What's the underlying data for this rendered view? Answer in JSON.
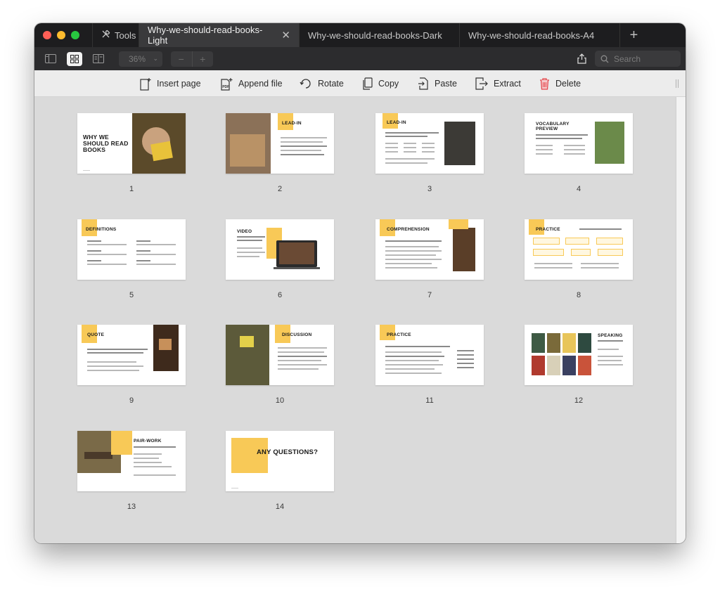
{
  "tabs": {
    "tools": "Tools",
    "items": [
      {
        "label": "Why-we-should-read-books-Light",
        "active": true
      },
      {
        "label": "Why-we-should-read-books-Dark",
        "active": false
      },
      {
        "label": "Why-we-should-read-books-A4",
        "active": false
      }
    ],
    "add": "+"
  },
  "toolbar": {
    "zoom": "36%",
    "zoom_out": "−",
    "zoom_in": "+",
    "search_placeholder": "Search"
  },
  "actions": {
    "insert_page": "Insert page",
    "append_file": "Append file",
    "rotate": "Rotate",
    "copy": "Copy",
    "paste": "Paste",
    "extract": "Extract",
    "delete": "Delete"
  },
  "colors": {
    "accent_yellow": "#f8c957",
    "delete_red": "#e5484d",
    "tabbar_bg": "#1d1d1f",
    "toolbar_bg": "#2c2c2e"
  },
  "pages": [
    {
      "number": "1",
      "title": "WHY WE SHOULD READ BOOKS"
    },
    {
      "number": "2",
      "title": "LEAD-IN"
    },
    {
      "number": "3",
      "title": "LEAD-IN"
    },
    {
      "number": "4",
      "title": "VOCABULARY PREVIEW"
    },
    {
      "number": "5",
      "title": "DEFINITIONS"
    },
    {
      "number": "6",
      "title": "VIDEO"
    },
    {
      "number": "7",
      "title": "COMPREHENSION"
    },
    {
      "number": "8",
      "title": "PRACTICE"
    },
    {
      "number": "9",
      "title": "QUOTE"
    },
    {
      "number": "10",
      "title": "DISCUSSION"
    },
    {
      "number": "11",
      "title": "PRACTICE"
    },
    {
      "number": "12",
      "title": "SPEAKING"
    },
    {
      "number": "13",
      "title": "PAIR-WORK"
    },
    {
      "number": "14",
      "title": "ANY QUESTIONS?"
    }
  ]
}
